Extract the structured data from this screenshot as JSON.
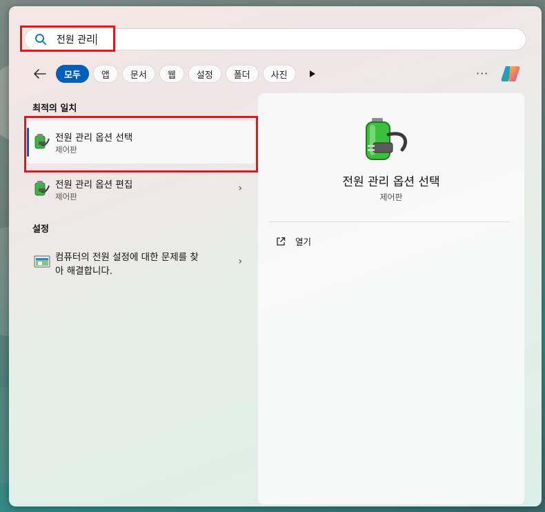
{
  "search": {
    "query": "전원 관리"
  },
  "filters": {
    "back_icon": "back-arrow-icon",
    "chips": [
      "모두",
      "앱",
      "문서",
      "웹",
      "설정",
      "폴더",
      "사진"
    ],
    "active_index": 0,
    "more_label": "···"
  },
  "results": {
    "best_match_header": "최적의 일치",
    "best_match": {
      "title": "전원 관리 옵션 선택",
      "subtitle": "제어판",
      "icon": "power-options-icon"
    },
    "items": [
      {
        "title": "전원 관리 옵션 편집",
        "subtitle": "제어판",
        "icon": "power-options-icon"
      }
    ],
    "settings_header": "설정",
    "settings_items": [
      {
        "title_line1": "컴퓨터의 전원 설정에 대한 문제를 찾",
        "title_line2": "아 해결합니다.",
        "icon": "troubleshoot-icon"
      }
    ]
  },
  "detail": {
    "title": "전원 관리 옵션 선택",
    "subtitle": "제어판",
    "actions": [
      {
        "label": "열기",
        "icon": "open-external-icon"
      }
    ]
  },
  "colors": {
    "accent": "#005fb8",
    "highlight": "#e3161c"
  }
}
